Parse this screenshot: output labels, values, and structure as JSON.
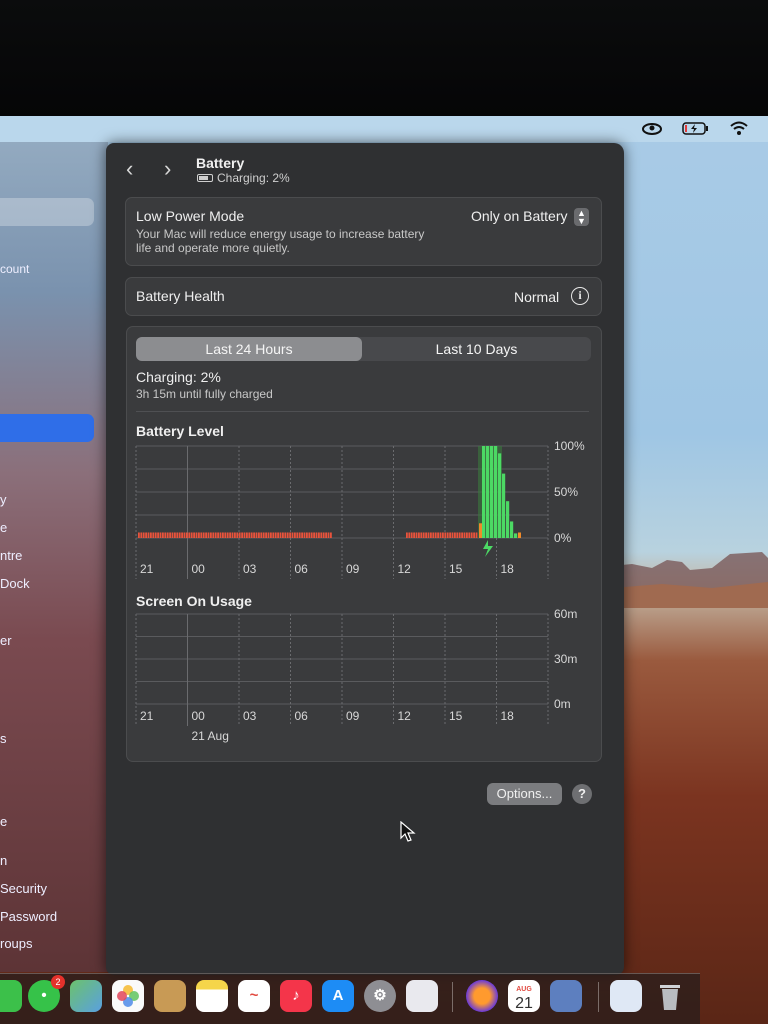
{
  "window": {
    "title": "Battery",
    "subtitle": "Charging: 2%"
  },
  "sidebar": {
    "items": [
      {
        "label": "count"
      },
      {
        "label": "y"
      },
      {
        "label": "e"
      },
      {
        "label": "ntre"
      },
      {
        "label": "Dock"
      },
      {
        "label": "er"
      },
      {
        "label": "s"
      },
      {
        "label": "e"
      },
      {
        "label": "n"
      },
      {
        "label": "Security"
      },
      {
        "label": "Password"
      },
      {
        "label": "roups"
      }
    ]
  },
  "low_power_mode": {
    "label": "Low Power Mode",
    "description_line1": "Your Mac will reduce energy usage to increase battery",
    "description_line2": "life and operate more quietly.",
    "value": "Only on Battery"
  },
  "battery_health": {
    "label": "Battery Health",
    "value": "Normal"
  },
  "tabs": {
    "left": "Last 24 Hours",
    "right": "Last 10 Days",
    "selected": "Last 24 Hours"
  },
  "status": {
    "charging": "Charging: 2%",
    "time_remaining": "3h 15m until fully charged"
  },
  "chart_data": [
    {
      "type": "bar",
      "title": "Battery Level",
      "x_tick_labels": [
        "21",
        "00",
        "03",
        "06",
        "09",
        "12",
        "15",
        "18"
      ],
      "y_tick_labels": [
        "100%",
        "50%",
        "0%"
      ],
      "ylim": [
        0,
        100
      ],
      "series": [
        {
          "values": [
            6,
            6,
            6,
            6,
            6,
            6,
            6,
            6,
            6,
            6,
            6,
            6,
            6,
            6,
            6,
            6,
            6,
            6,
            6,
            6,
            6,
            6,
            6,
            6,
            6,
            6,
            6,
            6,
            6,
            6,
            6,
            6,
            6,
            6,
            6,
            6,
            6,
            6,
            6,
            6,
            6,
            6,
            6,
            6,
            6,
            6,
            6,
            6,
            6,
            6,
            6,
            6,
            6,
            6,
            6,
            6,
            6,
            6,
            6,
            6,
            6,
            6,
            6,
            6,
            6,
            6,
            6,
            6,
            6,
            6,
            6,
            6,
            6,
            6,
            6,
            6,
            6,
            6,
            6,
            6,
            6,
            6,
            6,
            6,
            6,
            6,
            6,
            6,
            6,
            6,
            6,
            6,
            6,
            6,
            6,
            6,
            6,
            6,
            6,
            6,
            6,
            6,
            6,
            6,
            6,
            6,
            6,
            6,
            6,
            6,
            6,
            6,
            6,
            6,
            6,
            6,
            6,
            6,
            6,
            6,
            6,
            6,
            6,
            6,
            6,
            6,
            6,
            6,
            6,
            6,
            6,
            6,
            6,
            6,
            6,
            6,
            6,
            6,
            6,
            6,
            6,
            6,
            6,
            6,
            6,
            6,
            6,
            6,
            6,
            6,
            6,
            6,
            6,
            6,
            6,
            6,
            6,
            6,
            6,
            6,
            6,
            6,
            6,
            6,
            6,
            6,
            6,
            6,
            6,
            6,
            6,
            6,
            6,
            6,
            6,
            6,
            6,
            6,
            6,
            6,
            6,
            6,
            6,
            6,
            6,
            6,
            6,
            6,
            6,
            6,
            6,
            6,
            6,
            6,
            6,
            6,
            6,
            6,
            6,
            6,
            6,
            6,
            6,
            6,
            6,
            6,
            6,
            6,
            6,
            6,
            6,
            6,
            6,
            6,
            6,
            6,
            6,
            6,
            6,
            6,
            6,
            6,
            6,
            6,
            6,
            6,
            6,
            6,
            6,
            6,
            6,
            6,
            6,
            6,
            6,
            6,
            6,
            6,
            6,
            6,
            6,
            6,
            6,
            6,
            6,
            6,
            6,
            6,
            6,
            6,
            6,
            6,
            6,
            6,
            6,
            6,
            6,
            6,
            6,
            6,
            6,
            6,
            6,
            6,
            6,
            6,
            6,
            6,
            6,
            6,
            6,
            6,
            6,
            6,
            6,
            6,
            6,
            6,
            6,
            6,
            6,
            6,
            6,
            6,
            6,
            6
          ]
        }
      ],
      "charging_levels": [
        100,
        100,
        100,
        100,
        92,
        70,
        40,
        18,
        5
      ],
      "grid": true
    },
    {
      "type": "bar",
      "title": "Screen On Usage",
      "x_tick_labels": [
        "21",
        "00",
        "03",
        "06",
        "09",
        "12",
        "15",
        "18"
      ],
      "date_label": "21 Aug",
      "y_tick_labels": [
        "60m",
        "30m",
        "0m"
      ],
      "ylim": [
        0,
        60
      ],
      "series": [
        {
          "values": []
        }
      ],
      "grid": true
    }
  ],
  "options_button": "Options...",
  "help_button": "?",
  "dock": {
    "calendar_month": "AUG",
    "calendar_day": "21",
    "messages_badge": "2"
  }
}
